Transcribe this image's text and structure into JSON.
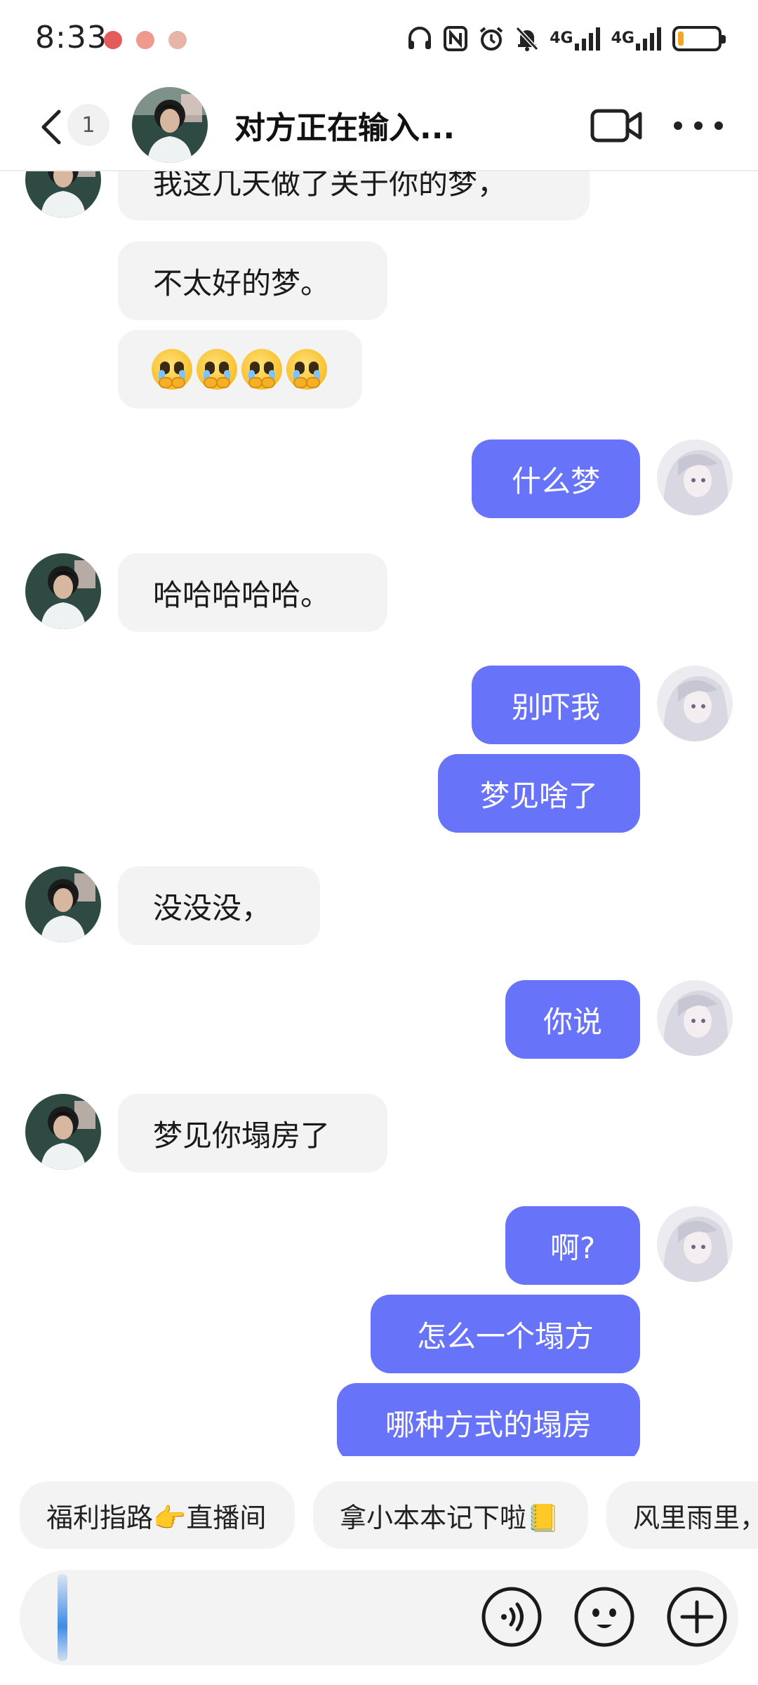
{
  "status_bar": {
    "time": "8:33",
    "network_1": "4G",
    "network_2": "4G",
    "battery_level": 0.15
  },
  "header": {
    "unread_count": "1",
    "title": "对方正在输入..."
  },
  "messages": [
    {
      "side": "in",
      "text": "我这几天做了关于你的梦，"
    },
    {
      "side": "in",
      "text": "不太好的梦。"
    },
    {
      "side": "in",
      "emoji": "pleading-face",
      "count": 4
    },
    {
      "side": "out",
      "text": "什么梦"
    },
    {
      "side": "in",
      "text": "哈哈哈哈哈。"
    },
    {
      "side": "out",
      "text": "别吓我"
    },
    {
      "side": "out",
      "text": "梦见啥了"
    },
    {
      "side": "in",
      "text": "没没没，"
    },
    {
      "side": "out",
      "text": "你说"
    },
    {
      "side": "in",
      "text": "梦见你塌房了"
    },
    {
      "side": "out",
      "text": "啊?"
    },
    {
      "side": "out",
      "text": "怎么一个塌方"
    },
    {
      "side": "out",
      "text": "哪种方式的塌房"
    }
  ],
  "quick_replies": [
    "福利指路👉直播间",
    "拿小本本记下啦📒",
    "风里雨里，"
  ],
  "colors": {
    "outgoing_bubble": "#6773f8",
    "incoming_bubble": "#f3f3f3"
  },
  "icons": {
    "back": "chevron-left-icon",
    "video": "video-camera-icon",
    "more": "more-dots-icon",
    "voice": "voice-icon",
    "emoji": "smiley-icon",
    "plus": "plus-icon"
  }
}
